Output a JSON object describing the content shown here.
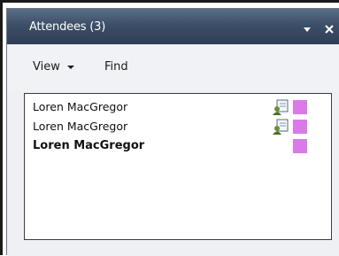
{
  "panel": {
    "title": "Attendees (3)"
  },
  "toolbar": {
    "view_label": "View",
    "find_label": "Find"
  },
  "attendees": [
    {
      "name": "Loren MacGregor",
      "bold": false,
      "has_icon": true,
      "swatch": "#d97ae8"
    },
    {
      "name": "Loren MacGregor",
      "bold": false,
      "has_icon": true,
      "swatch": "#d97ae8"
    },
    {
      "name": "Loren MacGregor",
      "bold": true,
      "has_icon": false,
      "swatch": "#d97ae8"
    }
  ],
  "colors": {
    "titlebar": "#3d4f68",
    "swatch": "#d97ae8"
  },
  "icons": {
    "dropdown": "chevron-down-icon",
    "close": "close-icon",
    "attendee_card": "contact-card-icon"
  }
}
